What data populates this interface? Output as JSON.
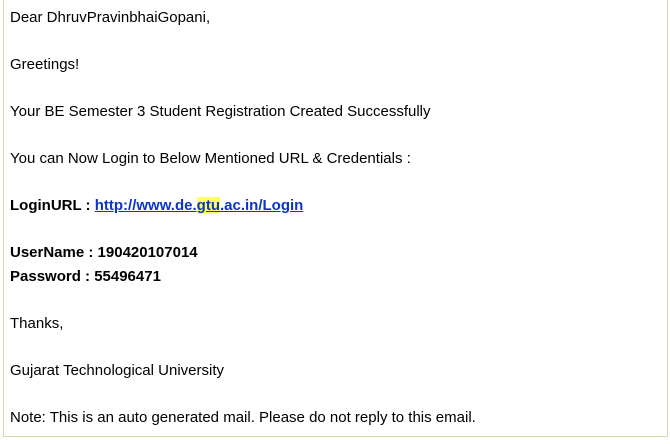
{
  "email": {
    "greeting": "Dear DhruvPravinbhaiGopani,",
    "salutation": "Greetings!",
    "registration_line": "Your BE Semester 3 Student Registration Created Successfully",
    "instruction_line": "You can Now Login to Below Mentioned URL & Credentials :",
    "login_url_label": "LoginURL : ",
    "login_url": {
      "prefix": "http://www.de.",
      "highlight": "gtu",
      "suffix": ".ac.in/Login"
    },
    "username_line": "UserName : 190420107014",
    "password_line": "Password : 55496471",
    "thanks": "Thanks,",
    "signature": "Gujarat Technological University",
    "note": "Note: This is an auto generated mail. Please do not reply to this email."
  },
  "colors": {
    "link": "#0a35c9",
    "highlight": "#ffff66",
    "frame_border": "#d9d8a2"
  }
}
